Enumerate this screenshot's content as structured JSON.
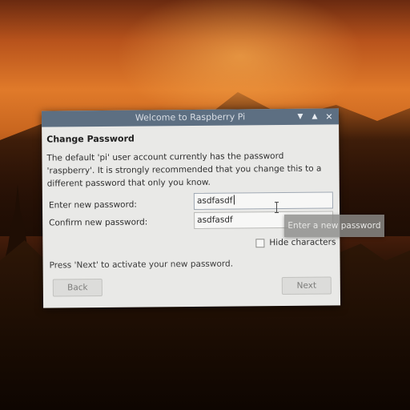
{
  "window": {
    "title": "Welcome to Raspberry Pi",
    "controls": {
      "minimize_icon": "chevron-down-icon",
      "maximize_icon": "chevron-up-icon",
      "close_icon": "close-icon"
    }
  },
  "page": {
    "heading": "Change Password",
    "description": "The default 'pi' user account currently has the password 'raspberry'. It is strongly recommended that you change this to a different password that only you know.",
    "new_password_label": "Enter new password:",
    "new_password_value": "asdfasdf",
    "confirm_password_label": "Confirm new password:",
    "confirm_password_value": "asdfasdf",
    "hide_characters_label": "Hide characters",
    "hide_characters_checked": false,
    "hint": "Press 'Next' to activate your new password."
  },
  "buttons": {
    "back": "Back",
    "next": "Next"
  },
  "tooltip": {
    "text": "Enter a new password"
  },
  "colors": {
    "titlebar": "#5d6f82",
    "dialog_background": "#e9e9e7"
  }
}
